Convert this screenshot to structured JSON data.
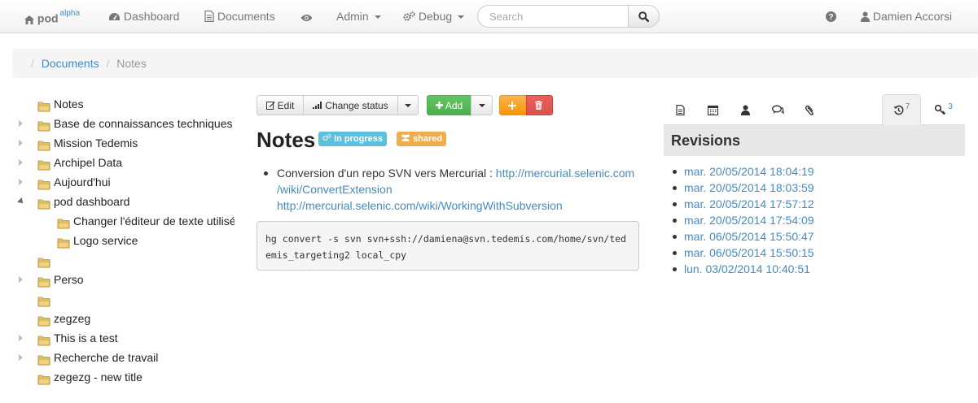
{
  "navbar": {
    "brand": "pod",
    "brand_sup": "alpha",
    "items": [
      {
        "label": "Dashboard",
        "icon": "dashboard-icon"
      },
      {
        "label": "Documents",
        "icon": "file-icon"
      },
      {
        "label": "",
        "icon": "eye-icon"
      },
      {
        "label": "Admin",
        "icon": ""
      },
      {
        "label": "Debug",
        "icon": "cogs-icon"
      }
    ],
    "search_placeholder": "Search",
    "search_value": "",
    "user": "Damien Accorsi"
  },
  "breadcrumb": {
    "items": [
      "Documents",
      "Notes"
    ]
  },
  "tree": [
    {
      "label": "Notes",
      "expander": "none"
    },
    {
      "label": "Base de connaissances techniques",
      "expander": "collapsed"
    },
    {
      "label": "Mission Tedemis",
      "expander": "collapsed"
    },
    {
      "label": "Archipel Data",
      "expander": "collapsed"
    },
    {
      "label": "Aujourd'hui",
      "expander": "collapsed"
    },
    {
      "label": "pod dashboard",
      "expander": "expanded"
    },
    {
      "label": "Changer l'éditeur de texte utilisé",
      "expander": "none",
      "child": true
    },
    {
      "label": "Logo service",
      "expander": "none",
      "child": true
    },
    {
      "label": "",
      "expander": "none"
    },
    {
      "label": "Perso",
      "expander": "collapsed"
    },
    {
      "label": "",
      "expander": "none"
    },
    {
      "label": "zegzeg",
      "expander": "none"
    },
    {
      "label": "This is a test",
      "expander": "collapsed"
    },
    {
      "label": "Recherche de travail",
      "expander": "collapsed"
    },
    {
      "label": "zegezg - new title",
      "expander": "none"
    }
  ],
  "toolbar": {
    "edit": "Edit",
    "change_status": "Change status",
    "add": "Add"
  },
  "document": {
    "title": "Notes",
    "status_label": "In progress",
    "shared_label": "shared",
    "bullet_text": "Conversion d'un repo SVN vers Mercurial : ",
    "link1": "http://mercurial.selenic.com/wiki/ConvertExtension",
    "link2": "http://mercurial.selenic.com/wiki/WorkingWithSubversion",
    "code": "hg convert -s svn svn+ssh://damiena@svn.tedemis.com/home/svn/tedemis_targeting2 local_cpy"
  },
  "side_panel": {
    "tabs": [
      {
        "icon": "file-icon",
        "count": ""
      },
      {
        "icon": "calendar-icon",
        "count": ""
      },
      {
        "icon": "user-icon",
        "count": ""
      },
      {
        "icon": "comments-icon",
        "count": ""
      },
      {
        "icon": "paperclip-icon",
        "count": ""
      },
      {
        "icon": "history-icon",
        "count": "7"
      },
      {
        "icon": "key-icon",
        "count": "3"
      }
    ],
    "header": "Revisions",
    "revisions": [
      "mar. 20/05/2014 18:04:19",
      "mar. 20/05/2014 18:03:59",
      "mar. 20/05/2014 17:57:12",
      "mar. 20/05/2014 17:54:09",
      "mar. 06/05/2014 15:50:47",
      "mar. 06/05/2014 15:50:15",
      "lun. 03/02/2014 10:40:51"
    ]
  },
  "colors": {
    "link": "#428bca",
    "label_info": "#5bc0de",
    "label_warning": "#f0ad4e",
    "btn_success": "#5cb85c",
    "btn_orange": "#f89406",
    "btn_danger": "#d9534f"
  }
}
